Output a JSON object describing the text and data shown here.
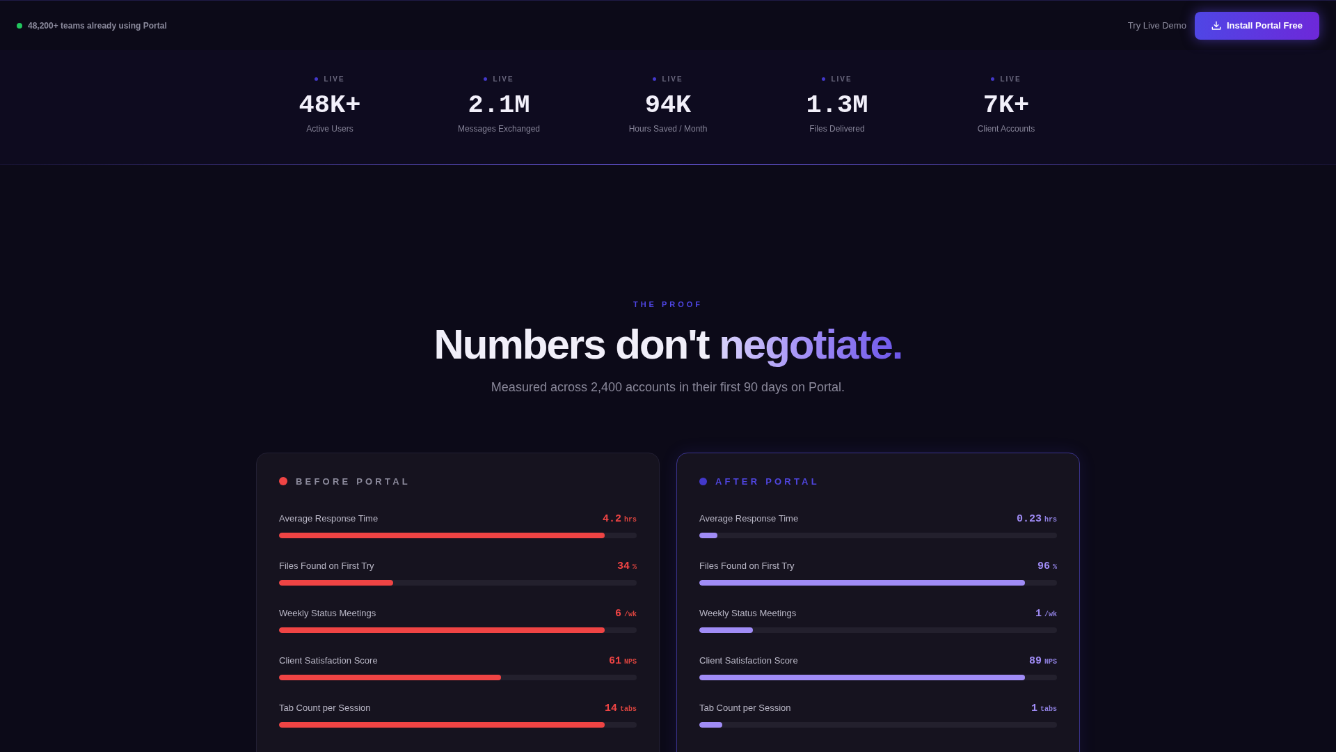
{
  "top_bar": {
    "social_proof": "48,200+ teams already using Portal",
    "demo_link": "Try Live Demo",
    "install_button": "Install Portal Free"
  },
  "stats": [
    {
      "badge": "LIVE",
      "value": "48K+",
      "label": "Active Users"
    },
    {
      "badge": "LIVE",
      "value": "2.1M",
      "label": "Messages Exchanged"
    },
    {
      "badge": "LIVE",
      "value": "94K",
      "label": "Hours Saved / Month"
    },
    {
      "badge": "LIVE",
      "value": "1.3M",
      "label": "Files Delivered"
    },
    {
      "badge": "LIVE",
      "value": "7K+",
      "label": "Client Accounts"
    }
  ],
  "proof": {
    "eyebrow": "THE PROOF",
    "heading": "Numbers don't",
    "heading_highlight": "negotiate.",
    "subtitle": "Measured across 2,400 accounts in their first 90 days on Portal."
  },
  "comparison": [
    {
      "kind": "before",
      "title": "BEFORE PORTAL",
      "metrics": [
        {
          "label": "Average Response Time",
          "value": "4.2",
          "unit": "hrs",
          "level": 0.91
        },
        {
          "label": "Files Found on First Try",
          "value": "34",
          "unit": "%",
          "level": 0.32
        },
        {
          "label": "Weekly Status Meetings",
          "value": "6",
          "unit": "/wk",
          "level": 0.91
        },
        {
          "label": "Client Satisfaction Score",
          "value": "61",
          "unit": "NPS",
          "level": 0.62
        },
        {
          "label": "Tab Count per Session",
          "value": "14",
          "unit": "tabs",
          "level": 0.91
        }
      ]
    },
    {
      "kind": "after",
      "title": "AFTER PORTAL",
      "metrics": [
        {
          "label": "Average Response Time",
          "value": "0.23",
          "unit": "hrs",
          "level": 0.05
        },
        {
          "label": "Files Found on First Try",
          "value": "96",
          "unit": "%",
          "level": 0.91
        },
        {
          "label": "Weekly Status Meetings",
          "value": "1",
          "unit": "/wk",
          "level": 0.15
        },
        {
          "label": "Client Satisfaction Score",
          "value": "89",
          "unit": "NPS",
          "level": 0.91
        },
        {
          "label": "Tab Count per Session",
          "value": "1",
          "unit": "tabs",
          "level": 0.064
        }
      ]
    }
  ]
}
